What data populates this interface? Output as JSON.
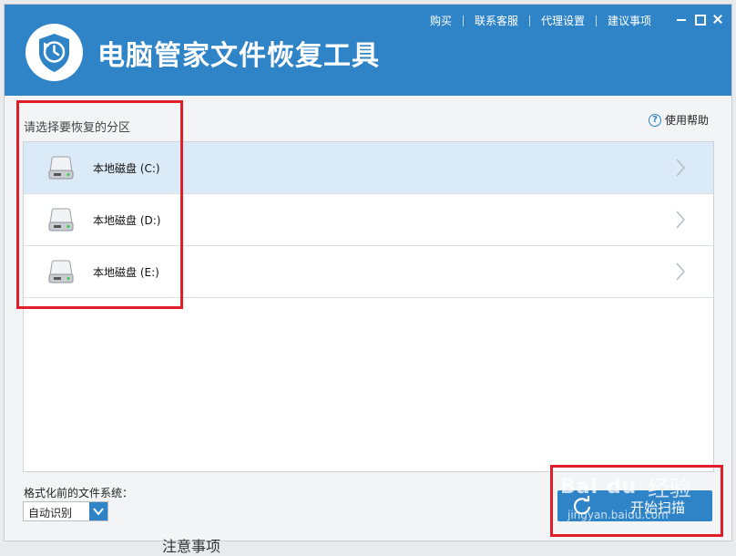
{
  "app": {
    "title": "电脑管家文件恢复工具",
    "menu": [
      "购买",
      "联系客服",
      "代理设置",
      "建议事项"
    ]
  },
  "main": {
    "prompt": "请选择要恢复的分区",
    "help_label": "使用帮助",
    "partitions": [
      {
        "label": "本地磁盘 (C:)",
        "selected": true
      },
      {
        "label": "本地磁盘 (D:)",
        "selected": false
      },
      {
        "label": "本地磁盘 (E:)",
        "selected": false
      }
    ]
  },
  "footer": {
    "fs_label": "格式化前的文件系统：",
    "fs_value": "自动识别",
    "scan_button": "开始扫描"
  },
  "watermark": {
    "logo": "Bai du",
    "text": "经验",
    "url": "jingyan.baidu.com"
  },
  "overlay": {
    "partial_text": "注意事项"
  },
  "colors": {
    "accent": "#2f83c7",
    "selected_row": "#dbeaf7",
    "highlight_box": "#e01e2a"
  }
}
